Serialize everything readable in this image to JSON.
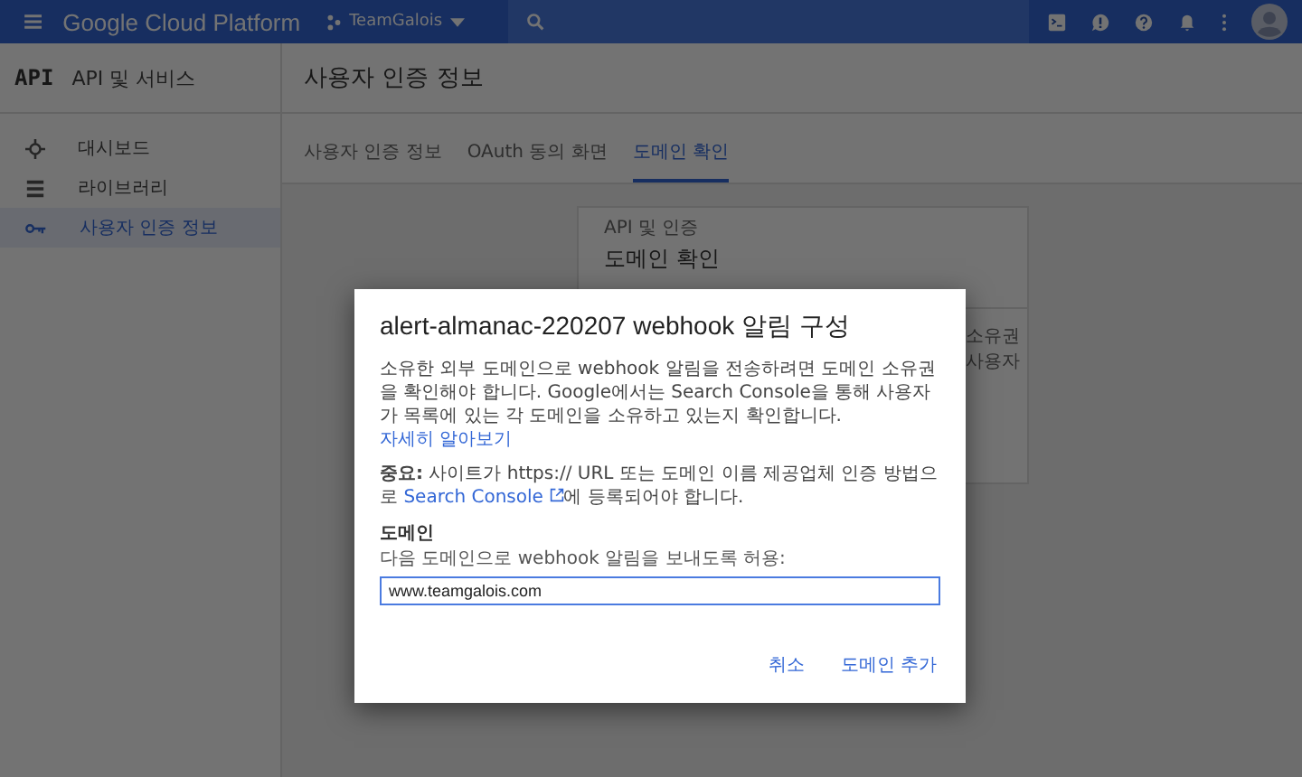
{
  "topbar": {
    "product": "Google Cloud Platform",
    "project": "TeamGalois"
  },
  "sidebar": {
    "logo": "API",
    "title": "API 및 서비스",
    "items": [
      {
        "label": "대시보드",
        "selected": false
      },
      {
        "label": "라이브러리",
        "selected": false
      },
      {
        "label": "사용자 인증 정보",
        "selected": true
      }
    ]
  },
  "page_title": "사용자 인증 정보",
  "tabs": [
    {
      "label": "사용자 인증 정보",
      "selected": false
    },
    {
      "label": "OAuth 동의 화면",
      "selected": false
    },
    {
      "label": "도메인 확인",
      "selected": true
    }
  ],
  "card": {
    "eyebrow": "API 및 인증",
    "title": "도메인 확인",
    "side_lines": [
      "소유권",
      "사용자"
    ]
  },
  "dialog": {
    "title": "alert-almanac-220207 webhook 알림 구성",
    "description": "소유한 외부 도메인으로 webhook 알림을 전송하려면 도메인 소유권을 확인해야 합니다. Google에서는 Search Console을 통해 사용자가 목록에 있는 각 도메인을 소유하고 있는지 확인합니다.",
    "learn_more": "자세히 알아보기",
    "note_label": "중요:",
    "note": "사이트가 https:// URL 또는 도메인 이름 제공업체 인증 방법으로",
    "note_link": "Search Console",
    "note_tail": "에 등록되어야 합니다.",
    "field_label": "도메인",
    "field_hint": "다음 도메인으로 webhook 알림을 보내도록 허용:",
    "field_value": "www.teamgalois.com",
    "buttons": [
      "취소",
      "도메인 추가"
    ]
  }
}
